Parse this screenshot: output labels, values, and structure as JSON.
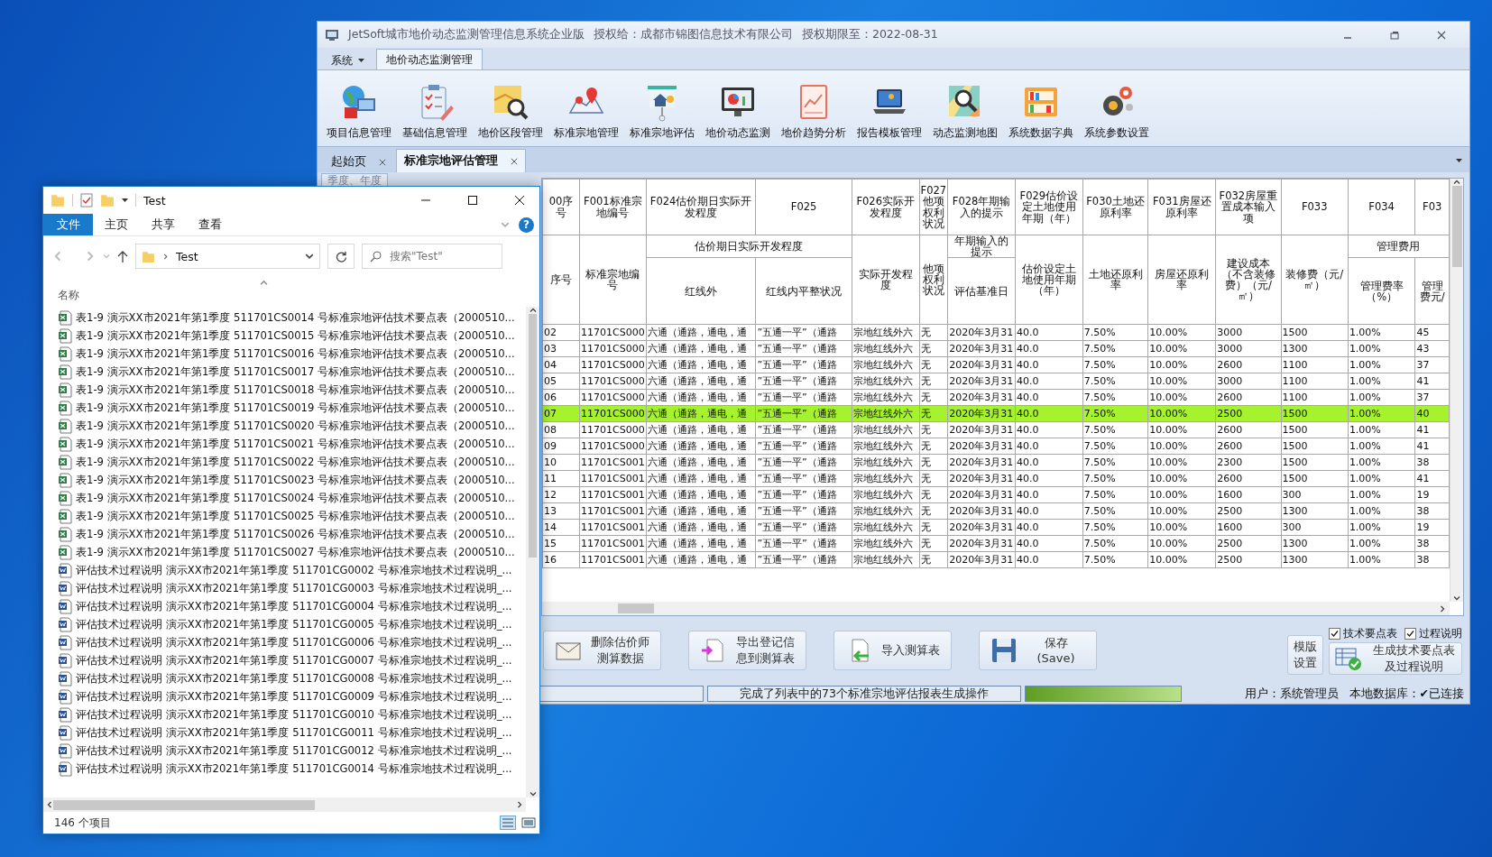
{
  "app": {
    "title": [
      "JetSoft城市地价动态监测管理信息系统企业版",
      "授权给：成都市锦图信息技术有限公司",
      "授权期限至：2022-08-31"
    ],
    "menu_tabs": [
      {
        "label": "系统",
        "kind": "menu",
        "selected": false
      },
      {
        "label": "地价动态监测管理",
        "kind": "tab",
        "selected": true
      }
    ],
    "ribbon": [
      "项目信息管理",
      "基础信息管理",
      "地价区段管理",
      "标准宗地管理",
      "标准宗地评估",
      "地价动态监测",
      "地价趋势分析",
      "报告模板管理",
      "动态监测地图",
      "系统数据字典",
      "系统参数设置"
    ],
    "doc_tabs": [
      {
        "label": "起始页",
        "selected": false
      },
      {
        "label": "标准宗地评估管理",
        "selected": true
      }
    ],
    "left_panel": {
      "tab": "季度、年度"
    },
    "table": {
      "columns": [
        {
          "code": "00序号",
          "name": "序号"
        },
        {
          "code": "F001标准宗地编号",
          "name": "标准宗地编号"
        },
        {
          "group": "估价期日实际开发程度",
          "code": "F024估价期日实际开发程度",
          "name": "红线外"
        },
        {
          "in_group": true,
          "code": "F025",
          "name": "红线内平整状况"
        },
        {
          "code": "F026实际开发程度",
          "name": "实际开发程度"
        },
        {
          "code": "F027他项权利状况",
          "name": "他项权利状况"
        },
        {
          "group": "年期输入的提示",
          "code": "F028年期输入的提示",
          "name": "评估基准日"
        },
        {
          "code": "F029估价设定土地使用年期（年）",
          "name": "估价设定土地使用年期（年）"
        },
        {
          "code": "F030土地还原利率",
          "name": "土地还原利率"
        },
        {
          "code": "F031房屋还原利率",
          "name": "房屋还原利率"
        },
        {
          "code": "F032房屋重置成本输入项",
          "name": "建设成本（不含装修费）（元/㎡）"
        },
        {
          "code": "F033",
          "name": "装修费（元/㎡）"
        },
        {
          "group": "管理费用",
          "code": "F034",
          "name": "管理费率（%）"
        },
        {
          "in_group": true,
          "code": "F03",
          "name": "管理费元/"
        }
      ],
      "rows": [
        {
          "selected": false,
          "cells": [
            "02",
            "11701CS000",
            "六通（通路，通电，通",
            "”五通一平”（通路",
            "宗地红线外六",
            "无",
            "2020年3月31",
            "40.0",
            "7.50%",
            "10.00%",
            "3000",
            "1500",
            "1.00%",
            "45"
          ]
        },
        {
          "selected": false,
          "cells": [
            "03",
            "11701CS000",
            "六通（通路，通电，通",
            "”五通一平”（通路",
            "宗地红线外六",
            "无",
            "2020年3月31",
            "40.0",
            "7.50%",
            "10.00%",
            "3000",
            "1300",
            "1.00%",
            "43"
          ]
        },
        {
          "selected": false,
          "cells": [
            "04",
            "11701CS000",
            "六通（通路，通电，通",
            "”五通一平”（通路",
            "宗地红线外六",
            "无",
            "2020年3月31",
            "40.0",
            "7.50%",
            "10.00%",
            "2600",
            "1100",
            "1.00%",
            "37"
          ]
        },
        {
          "selected": false,
          "cells": [
            "05",
            "11701CS000",
            "六通（通路，通电，通",
            "”五通一平”（通路",
            "宗地红线外六",
            "无",
            "2020年3月31",
            "40.0",
            "7.50%",
            "10.00%",
            "3000",
            "1100",
            "1.00%",
            "41"
          ]
        },
        {
          "selected": false,
          "cells": [
            "06",
            "11701CS000",
            "六通（通路，通电，通",
            "”五通一平”（通路",
            "宗地红线外六",
            "无",
            "2020年3月31",
            "40.0",
            "7.50%",
            "10.00%",
            "2600",
            "1100",
            "1.00%",
            "37"
          ]
        },
        {
          "selected": true,
          "cells": [
            "07",
            "11701CS000",
            "六通（通路，通电，通",
            "”五通一平”（通路",
            "宗地红线外六",
            "无",
            "2020年3月31",
            "40.0",
            "7.50%",
            "10.00%",
            "2500",
            "1500",
            "1.00%",
            "40"
          ]
        },
        {
          "selected": false,
          "cells": [
            "08",
            "11701CS000",
            "六通（通路，通电，通",
            "”五通一平”（通路",
            "宗地红线外六",
            "无",
            "2020年3月31",
            "40.0",
            "7.50%",
            "10.00%",
            "2600",
            "1500",
            "1.00%",
            "41"
          ]
        },
        {
          "selected": false,
          "cells": [
            "09",
            "11701CS000",
            "六通（通路，通电，通",
            "”五通一平”（通路",
            "宗地红线外六",
            "无",
            "2020年3月31",
            "40.0",
            "7.50%",
            "10.00%",
            "2600",
            "1500",
            "1.00%",
            "41"
          ]
        },
        {
          "selected": false,
          "cells": [
            "10",
            "11701CS001",
            "六通（通路，通电，通",
            "”五通一平”（通路",
            "宗地红线外六",
            "无",
            "2020年3月31",
            "40.0",
            "7.50%",
            "10.00%",
            "2300",
            "1500",
            "1.00%",
            "38"
          ]
        },
        {
          "selected": false,
          "cells": [
            "11",
            "11701CS001",
            "六通（通路，通电，通",
            "”五通一平”（通路",
            "宗地红线外六",
            "无",
            "2020年3月31",
            "40.0",
            "7.50%",
            "10.00%",
            "2600",
            "1500",
            "1.00%",
            "41"
          ]
        },
        {
          "selected": false,
          "cells": [
            "12",
            "11701CS001",
            "六通（通路，通电，通",
            "”五通一平”（通路",
            "宗地红线外六",
            "无",
            "2020年3月31",
            "40.0",
            "7.50%",
            "10.00%",
            "1600",
            "300",
            "1.00%",
            "19"
          ]
        },
        {
          "selected": false,
          "cells": [
            "13",
            "11701CS001",
            "六通（通路，通电，通",
            "”五通一平”（通路",
            "宗地红线外六",
            "无",
            "2020年3月31",
            "40.0",
            "7.50%",
            "10.00%",
            "2500",
            "1300",
            "1.00%",
            "38"
          ]
        },
        {
          "selected": false,
          "cells": [
            "14",
            "11701CS001",
            "六通（通路，通电，通",
            "”五通一平”（通路",
            "宗地红线外六",
            "无",
            "2020年3月31",
            "40.0",
            "7.50%",
            "10.00%",
            "1600",
            "300",
            "1.00%",
            "19"
          ]
        },
        {
          "selected": false,
          "cells": [
            "15",
            "11701CS001",
            "六通（通路，通电，通",
            "”五通一平”（通路",
            "宗地红线外六",
            "无",
            "2020年3月31",
            "40.0",
            "7.50%",
            "10.00%",
            "2500",
            "1300",
            "1.00%",
            "38"
          ]
        },
        {
          "selected": false,
          "cells": [
            "16",
            "11701CS001",
            "六通（通路，通电，通",
            "”五通一平”（通路",
            "宗地红线外六",
            "无",
            "2020年3月31",
            "40.0",
            "7.50%",
            "10.00%",
            "2500",
            "1300",
            "1.00%",
            "38"
          ]
        }
      ]
    },
    "actions": [
      {
        "label": "删除估价师测算数据",
        "kind": "delete"
      },
      {
        "label": "导出登记信息到测算表",
        "kind": "export"
      },
      {
        "label": "导入测算表",
        "kind": "import"
      },
      {
        "label": "保存\n(Save)",
        "kind": "save"
      }
    ],
    "options": [
      {
        "label": "技术要点表",
        "checked": true
      },
      {
        "label": "过程说明",
        "checked": true
      }
    ],
    "template_button": "模版设置",
    "generate_button": "生成技术要点表及过程说明",
    "status": {
      "message": "完成了列表中的73个标准宗地评估报表生成操作",
      "progress": {
        "level": 1
      },
      "user": "用户：系统管理员",
      "db": "本地数据库：✔已连接"
    }
  },
  "explorer": {
    "title": "Test",
    "tabs": [
      {
        "label": "文件",
        "selected": true
      },
      {
        "label": "主页",
        "selected": false
      },
      {
        "label": "共享",
        "selected": false
      },
      {
        "label": "查看",
        "selected": false
      }
    ],
    "help": "?",
    "address": "Test",
    "search": {
      "placeholder": "搜索\"Test\""
    },
    "column": "名称",
    "files": [
      {
        "kind": "excel",
        "name": "表1-9 演示XX市2021年第1季度 511701CS0014 号标准宗地评估技术要点表（2000510..."
      },
      {
        "kind": "excel",
        "name": "表1-9 演示XX市2021年第1季度 511701CS0015 号标准宗地评估技术要点表（2000510..."
      },
      {
        "kind": "excel",
        "name": "表1-9 演示XX市2021年第1季度 511701CS0016 号标准宗地评估技术要点表（2000510..."
      },
      {
        "kind": "excel",
        "name": "表1-9 演示XX市2021年第1季度 511701CS0017 号标准宗地评估技术要点表（2000510..."
      },
      {
        "kind": "excel",
        "name": "表1-9 演示XX市2021年第1季度 511701CS0018 号标准宗地评估技术要点表（2000510..."
      },
      {
        "kind": "excel",
        "name": "表1-9 演示XX市2021年第1季度 511701CS0019 号标准宗地评估技术要点表（2000510..."
      },
      {
        "kind": "excel",
        "name": "表1-9 演示XX市2021年第1季度 511701CS0020 号标准宗地评估技术要点表（2000510..."
      },
      {
        "kind": "excel",
        "name": "表1-9 演示XX市2021年第1季度 511701CS0021 号标准宗地评估技术要点表（2000510..."
      },
      {
        "kind": "excel",
        "name": "表1-9 演示XX市2021年第1季度 511701CS0022 号标准宗地评估技术要点表（2000510..."
      },
      {
        "kind": "excel",
        "name": "表1-9 演示XX市2021年第1季度 511701CS0023 号标准宗地评估技术要点表（2000510..."
      },
      {
        "kind": "excel",
        "name": "表1-9 演示XX市2021年第1季度 511701CS0024 号标准宗地评估技术要点表（2000510..."
      },
      {
        "kind": "excel",
        "name": "表1-9 演示XX市2021年第1季度 511701CS0025 号标准宗地评估技术要点表（2000510..."
      },
      {
        "kind": "excel",
        "name": "表1-9 演示XX市2021年第1季度 511701CS0026 号标准宗地评估技术要点表（2000510..."
      },
      {
        "kind": "excel",
        "name": "表1-9 演示XX市2021年第1季度 511701CS0027 号标准宗地评估技术要点表（2000510..."
      },
      {
        "kind": "word",
        "name": "评估技术过程说明 演示XX市2021年第1季度 511701CG0002 号标准宗地技术过程说明_..."
      },
      {
        "kind": "word",
        "name": "评估技术过程说明 演示XX市2021年第1季度 511701CG0003 号标准宗地技术过程说明_..."
      },
      {
        "kind": "word",
        "name": "评估技术过程说明 演示XX市2021年第1季度 511701CG0004 号标准宗地技术过程说明_..."
      },
      {
        "kind": "word",
        "name": "评估技术过程说明 演示XX市2021年第1季度 511701CG0005 号标准宗地技术过程说明_..."
      },
      {
        "kind": "word",
        "name": "评估技术过程说明 演示XX市2021年第1季度 511701CG0006 号标准宗地技术过程说明_..."
      },
      {
        "kind": "word",
        "name": "评估技术过程说明 演示XX市2021年第1季度 511701CG0007 号标准宗地技术过程说明_..."
      },
      {
        "kind": "word",
        "name": "评估技术过程说明 演示XX市2021年第1季度 511701CG0008 号标准宗地技术过程说明_..."
      },
      {
        "kind": "word",
        "name": "评估技术过程说明 演示XX市2021年第1季度 511701CG0009 号标准宗地技术过程说明_..."
      },
      {
        "kind": "word",
        "name": "评估技术过程说明 演示XX市2021年第1季度 511701CG0010 号标准宗地技术过程说明_..."
      },
      {
        "kind": "word",
        "name": "评估技术过程说明 演示XX市2021年第1季度 511701CG0011 号标准宗地技术过程说明_..."
      },
      {
        "kind": "word",
        "name": "评估技术过程说明 演示XX市2021年第1季度 511701CG0012 号标准宗地技术过程说明_..."
      },
      {
        "kind": "word",
        "name": "评估技术过程说明 演示XX市2021年第1季度 511701CG0014 号标准宗地技术过程说明_..."
      }
    ],
    "status": "146 个项目"
  }
}
